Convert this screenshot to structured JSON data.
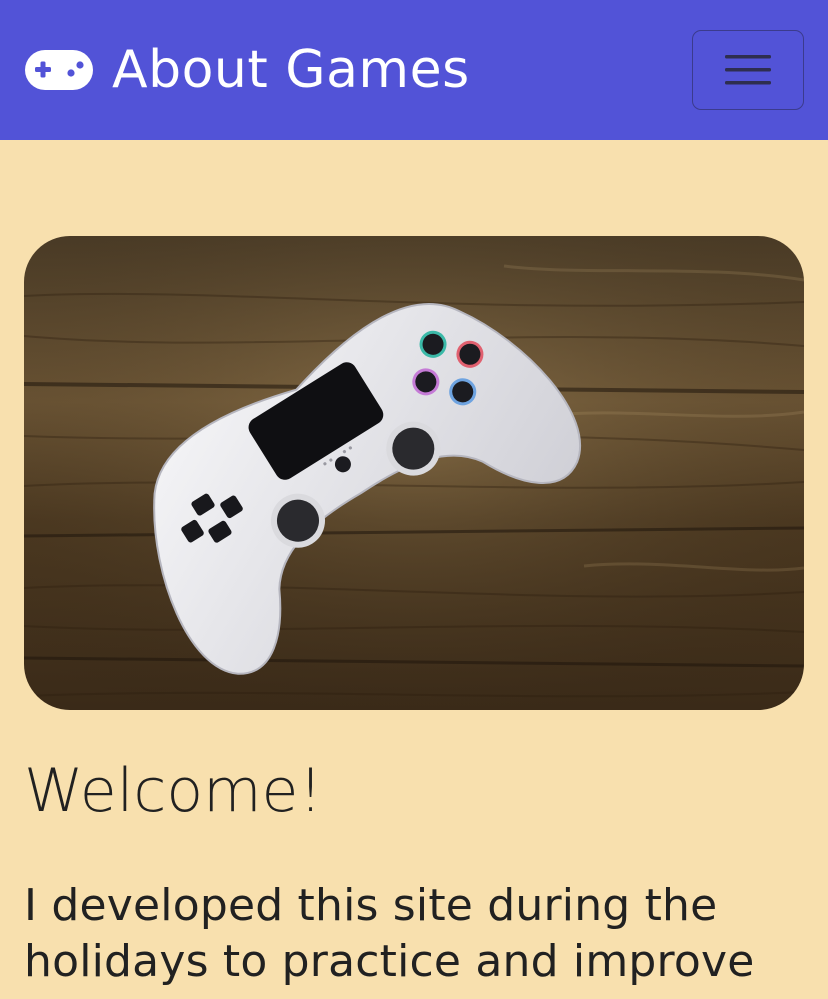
{
  "navbar": {
    "brand_text": "About Games",
    "brand_icon": "gamepad-icon",
    "menu_icon": "hamburger-menu-icon",
    "background": "#5253d7"
  },
  "hero": {
    "image": "game-controller-on-wooden-table"
  },
  "content": {
    "heading": "Welcome!",
    "intro": "I developed this site during the holidays to practice and improve"
  },
  "colors": {
    "page_background": "#f8e0ae",
    "text": "#212121"
  }
}
